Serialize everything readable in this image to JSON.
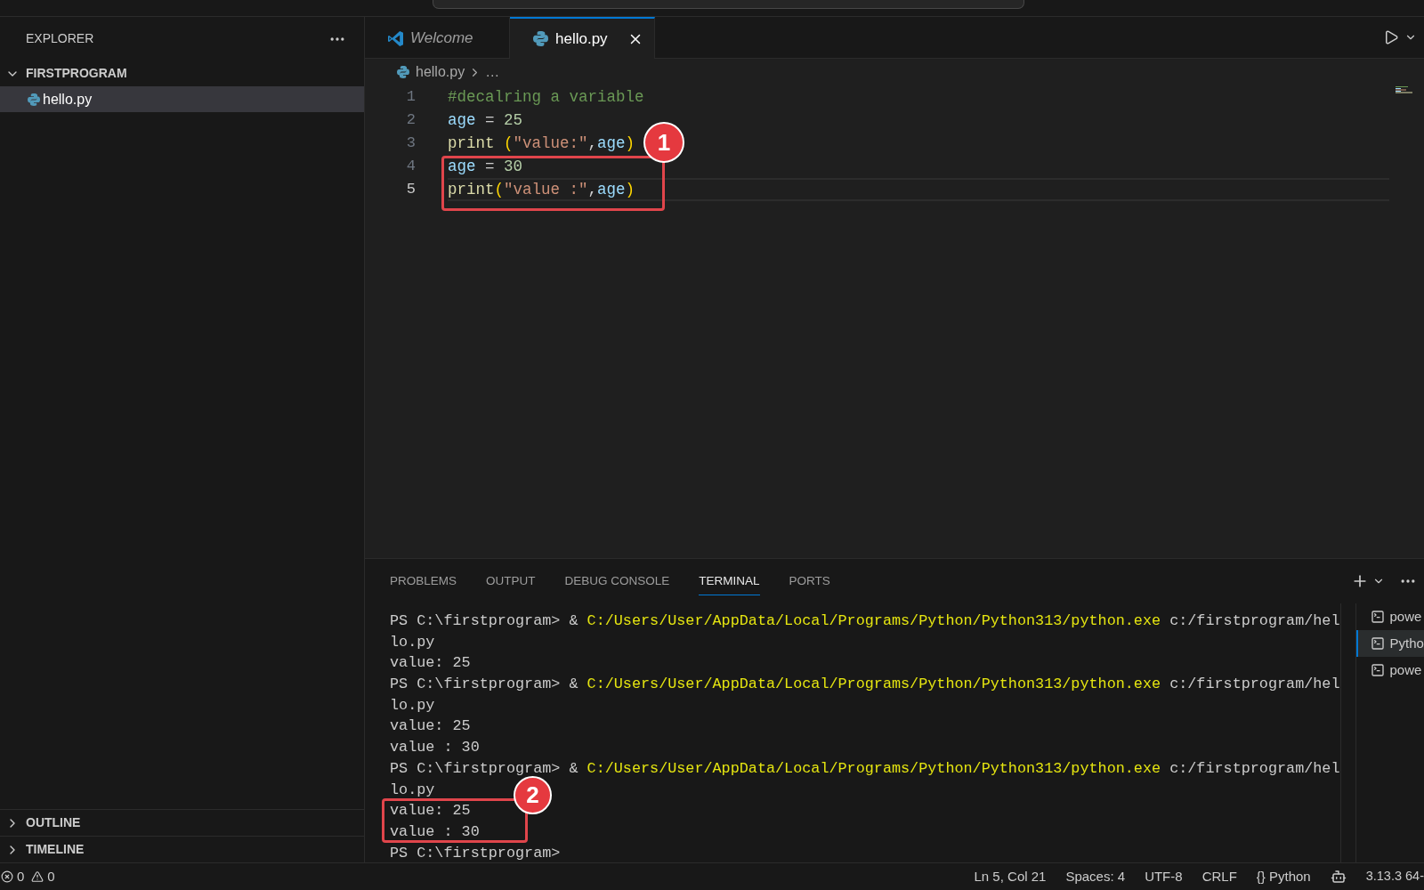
{
  "sidebar": {
    "title": "EXPLORER",
    "folder": {
      "name": "FIRSTPROGRAM",
      "expanded": true,
      "children": [
        {
          "name": "hello.py",
          "kind": "python",
          "selected": true
        }
      ]
    },
    "sections": [
      {
        "name": "OUTLINE",
        "expanded": false
      },
      {
        "name": "TIMELINE",
        "expanded": false
      }
    ]
  },
  "tabs": [
    {
      "label": "Welcome",
      "kind": "welcome",
      "preview": true,
      "selected": false
    },
    {
      "label": "hello.py",
      "kind": "python",
      "preview": false,
      "selected": true
    }
  ],
  "breadcrumb": [
    "hello.py",
    "…"
  ],
  "editor": {
    "lines": [
      {
        "number": "1",
        "active": false,
        "tokens": [
          {
            "kind": "comment",
            "text": "#decalring a variable"
          }
        ]
      },
      {
        "number": "2",
        "active": false,
        "tokens": [
          {
            "kind": "variable",
            "text": "age"
          },
          {
            "kind": "plain",
            "text": " = "
          },
          {
            "kind": "number",
            "text": "25"
          }
        ]
      },
      {
        "number": "3",
        "active": false,
        "tokens": [
          {
            "kind": "function",
            "text": "print "
          },
          {
            "kind": "bracket",
            "text": "("
          },
          {
            "kind": "string",
            "text": "\"value:\""
          },
          {
            "kind": "plain",
            "text": ","
          },
          {
            "kind": "variable",
            "text": "age"
          },
          {
            "kind": "bracket",
            "text": ")"
          }
        ]
      },
      {
        "number": "4",
        "active": false,
        "tokens": [
          {
            "kind": "variable",
            "text": "age"
          },
          {
            "kind": "plain",
            "text": " = "
          },
          {
            "kind": "number",
            "text": "30"
          }
        ]
      },
      {
        "number": "5",
        "active": true,
        "tokens": [
          {
            "kind": "function",
            "text": "print"
          },
          {
            "kind": "bracket",
            "text": "("
          },
          {
            "kind": "string",
            "text": "\"value :\""
          },
          {
            "kind": "plain",
            "text": ","
          },
          {
            "kind": "variable",
            "text": "age"
          },
          {
            "kind": "bracket",
            "text": ")"
          }
        ]
      }
    ]
  },
  "annotations": [
    {
      "label": "1"
    },
    {
      "label": "2"
    }
  ],
  "panel": {
    "tabs": [
      {
        "label": "PROBLEMS",
        "selected": false
      },
      {
        "label": "OUTPUT",
        "selected": false
      },
      {
        "label": "DEBUG CONSOLE",
        "selected": false
      },
      {
        "label": "TERMINAL",
        "selected": true
      },
      {
        "label": "PORTS",
        "selected": false
      }
    ],
    "terminal": {
      "lines": [
        {
          "segments": [
            {
              "kind": "plain",
              "text": "PS C:\\firstprogram> & "
            },
            {
              "kind": "executable",
              "text": "C:/Users/User/AppData/Local/Programs/Python/Python313/python.exe"
            },
            {
              "kind": "plain",
              "text": " c:/firstprogram/hel"
            }
          ]
        },
        {
          "segments": [
            {
              "kind": "plain",
              "text": "lo.py"
            }
          ]
        },
        {
          "segments": [
            {
              "kind": "plain",
              "text": "value: 25"
            }
          ]
        },
        {
          "segments": [
            {
              "kind": "plain",
              "text": "PS C:\\firstprogram> & "
            },
            {
              "kind": "executable",
              "text": "C:/Users/User/AppData/Local/Programs/Python/Python313/python.exe"
            },
            {
              "kind": "plain",
              "text": " c:/firstprogram/hel"
            }
          ]
        },
        {
          "segments": [
            {
              "kind": "plain",
              "text": "lo.py"
            }
          ]
        },
        {
          "segments": [
            {
              "kind": "plain",
              "text": "value: 25"
            }
          ]
        },
        {
          "segments": [
            {
              "kind": "plain",
              "text": "value : 30"
            }
          ]
        },
        {
          "segments": [
            {
              "kind": "plain",
              "text": "PS C:\\firstprogram> & "
            },
            {
              "kind": "executable",
              "text": "C:/Users/User/AppData/Local/Programs/Python/Python313/python.exe"
            },
            {
              "kind": "plain",
              "text": " c:/firstprogram/hel"
            }
          ]
        },
        {
          "segments": [
            {
              "kind": "plain",
              "text": "lo.py"
            }
          ]
        },
        {
          "segments": [
            {
              "kind": "plain",
              "text": "value: 25"
            }
          ]
        },
        {
          "segments": [
            {
              "kind": "plain",
              "text": "value : 30"
            }
          ]
        },
        {
          "segments": [
            {
              "kind": "plain",
              "text": "PS C:\\firstprogram>"
            }
          ]
        }
      ]
    },
    "terminals": [
      {
        "label": "powe",
        "selected": false
      },
      {
        "label": "Pytho",
        "selected": true
      },
      {
        "label": "powe",
        "selected": false
      }
    ]
  },
  "status_bar": {
    "errors": "0",
    "warnings": "0",
    "items": [
      "Ln 5, Col 21",
      "Spaces: 4",
      "UTF-8",
      "CRLF"
    ],
    "language": {
      "icon": "{}",
      "label": "Python"
    },
    "interpreter": "3.13.3 64-"
  }
}
